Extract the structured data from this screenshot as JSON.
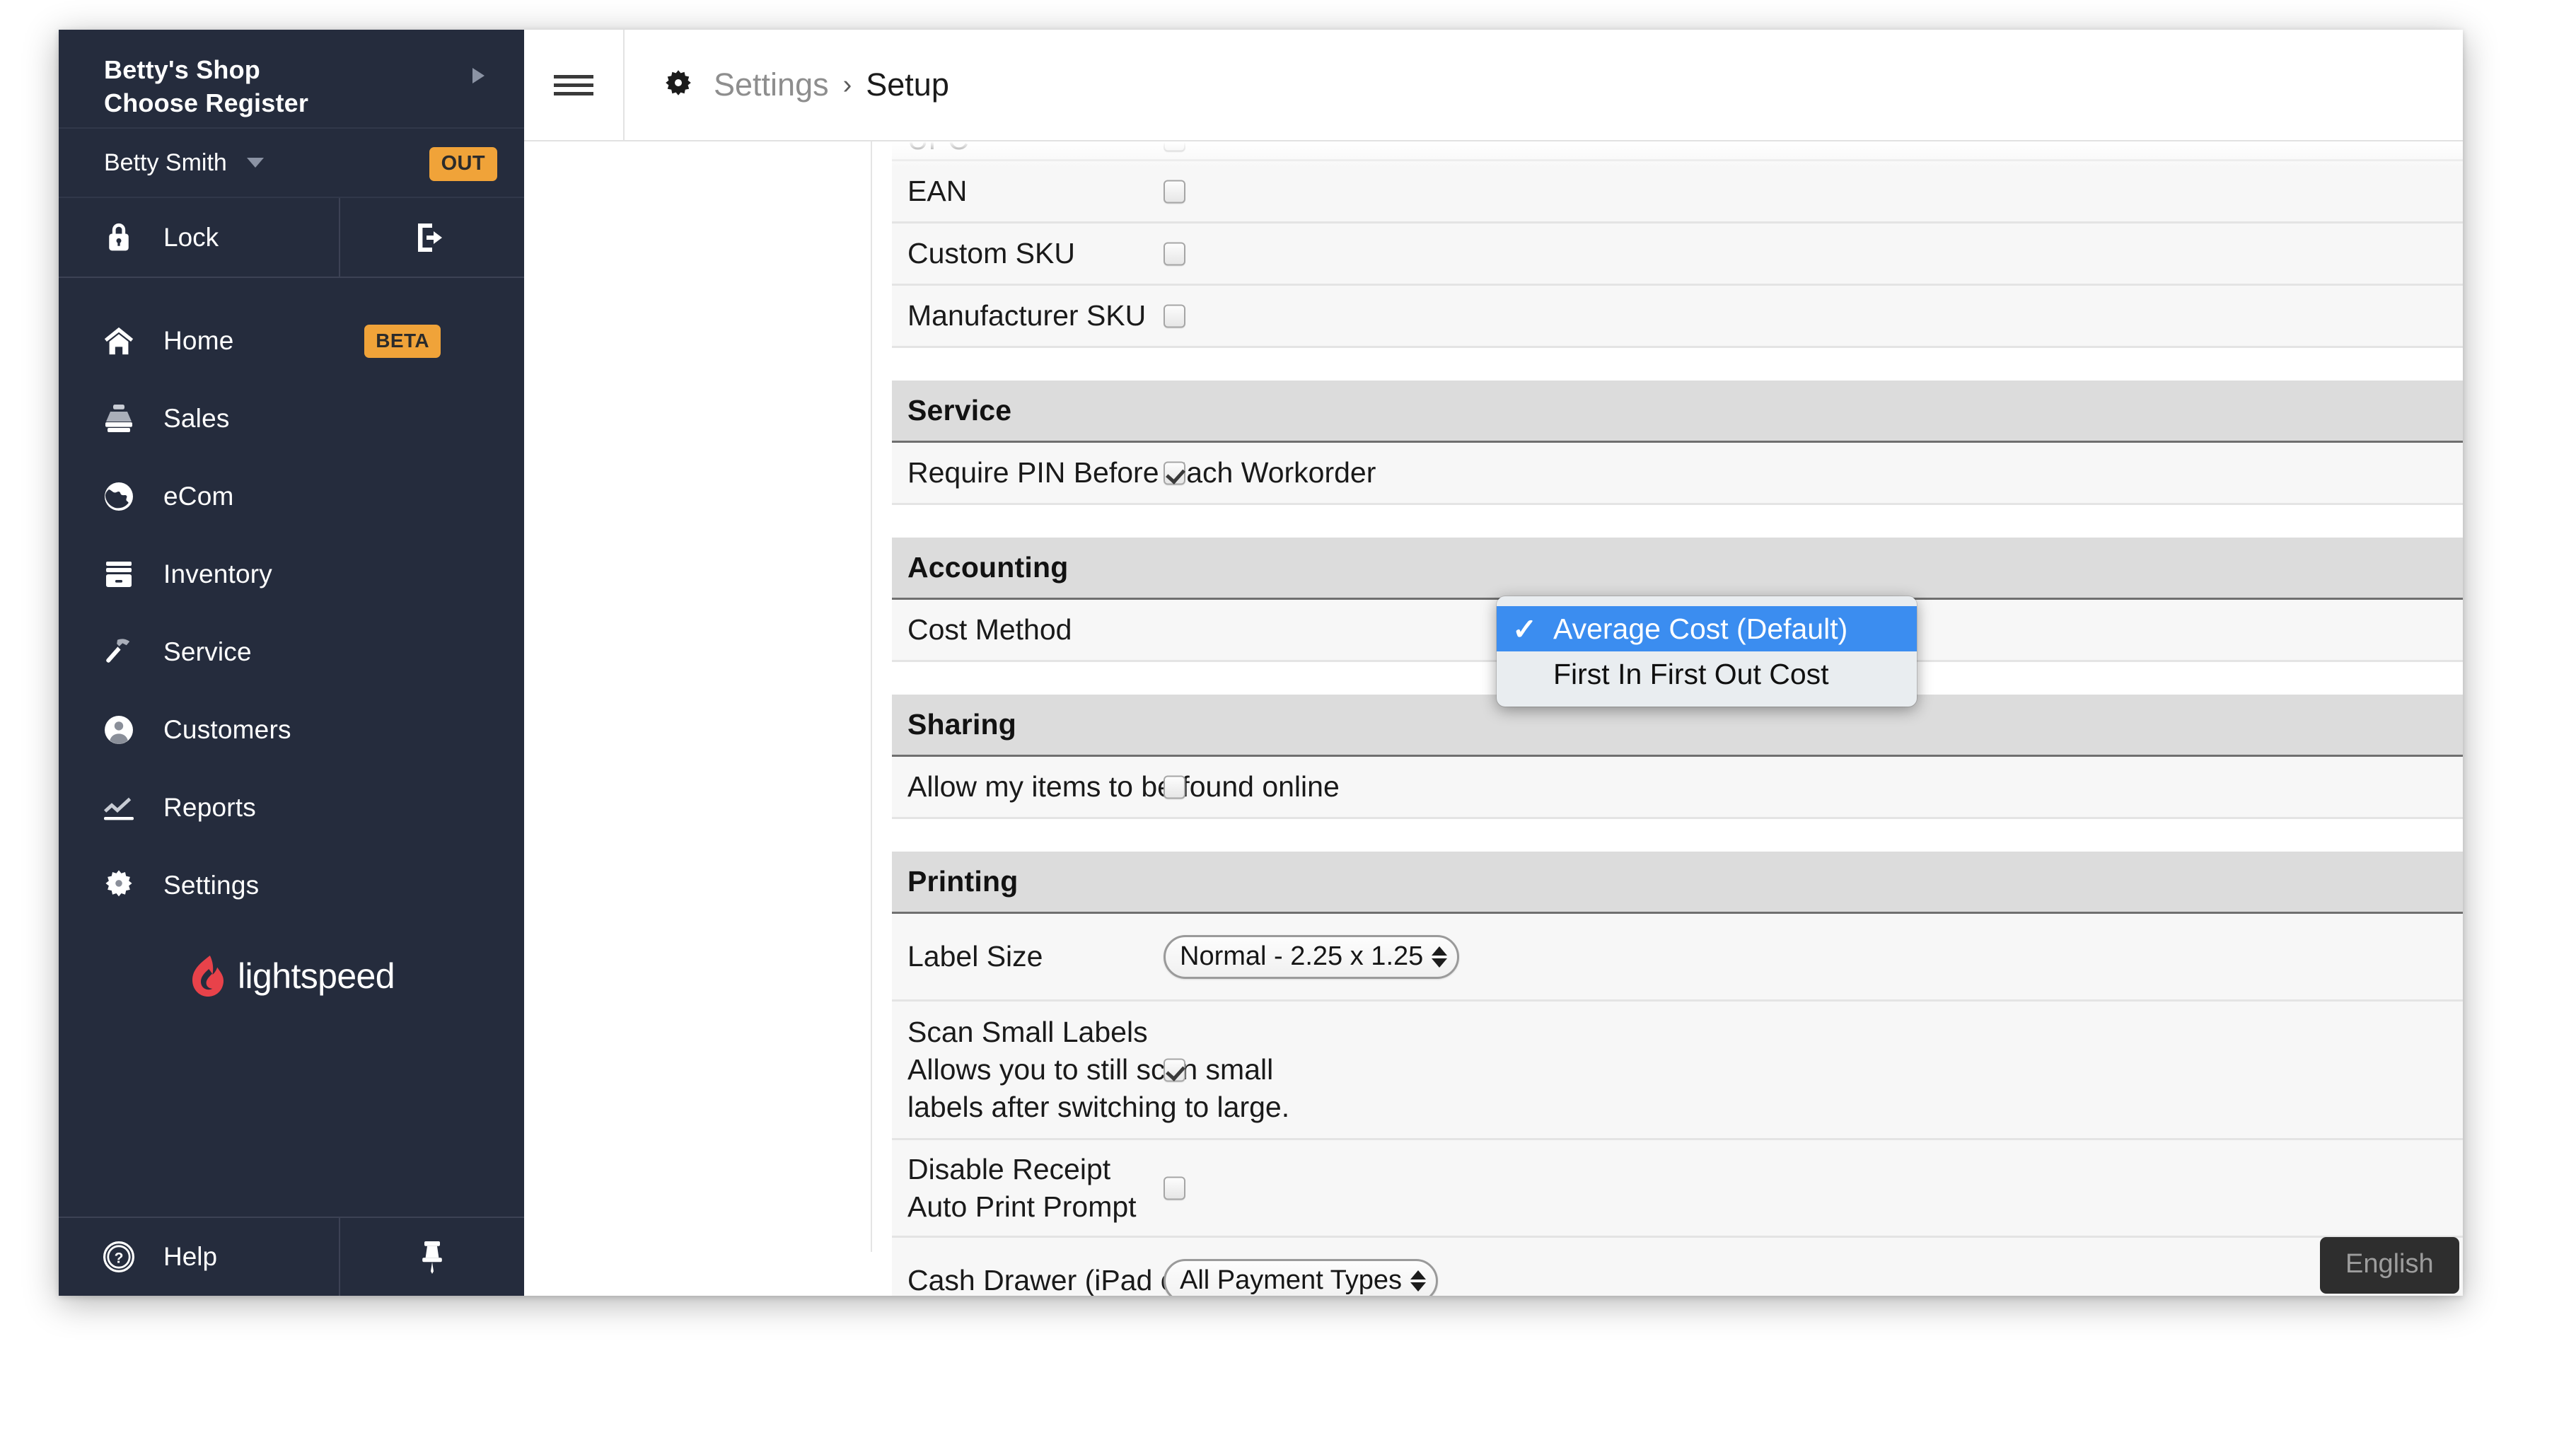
{
  "sidebar": {
    "shop_name": "Betty's Shop",
    "register_label": "Choose Register",
    "user_name": "Betty Smith",
    "clock_status": "OUT",
    "lock_label": "Lock",
    "nav_items": [
      {
        "label": "Home",
        "icon": "home-icon",
        "badge": "BETA"
      },
      {
        "label": "Sales",
        "icon": "register-icon",
        "badge": ""
      },
      {
        "label": "eCom",
        "icon": "globe-icon",
        "badge": ""
      },
      {
        "label": "Inventory",
        "icon": "boxes-icon",
        "badge": ""
      },
      {
        "label": "Service",
        "icon": "hammer-icon",
        "badge": ""
      },
      {
        "label": "Customers",
        "icon": "person-icon",
        "badge": ""
      },
      {
        "label": "Reports",
        "icon": "chart-line-icon",
        "badge": ""
      },
      {
        "label": "Settings",
        "icon": "gear-icon",
        "badge": ""
      }
    ],
    "brand": "lightspeed",
    "help_label": "Help"
  },
  "header": {
    "breadcrumb_parent": "Settings",
    "breadcrumb_separator": "›",
    "breadcrumb_current": "Setup"
  },
  "settings": {
    "top_rows": [
      {
        "label": "UPC",
        "checked": false
      },
      {
        "label": "EAN",
        "checked": false
      },
      {
        "label": "Custom SKU",
        "checked": false
      },
      {
        "label": "Manufacturer SKU",
        "checked": false
      }
    ],
    "sections": [
      {
        "title": "Service",
        "rows": [
          {
            "label": "Require PIN Before Each Workorder",
            "type": "checkbox",
            "checked": true
          }
        ]
      },
      {
        "title": "Accounting",
        "rows": [
          {
            "label": "Cost Method",
            "type": "select",
            "value": "Average Cost (Default)"
          }
        ]
      },
      {
        "title": "Sharing",
        "rows": [
          {
            "label": "Allow my items to be found online",
            "type": "checkbox",
            "checked": false
          }
        ]
      },
      {
        "title": "Printing",
        "rows": [
          {
            "label": "Label Size",
            "type": "select",
            "value": "Normal - 2.25 x 1.25"
          },
          {
            "label": "Scan Small Labels",
            "label_line2": "Allows you to still scan small",
            "label_line3": "labels after switching to large.",
            "type": "checkbox",
            "checked": true
          },
          {
            "label": "Disable Receipt",
            "label_line2": "Auto Print Prompt",
            "type": "checkbox",
            "checked": false
          },
          {
            "label": "Cash Drawer (iPad only)",
            "type": "select",
            "value": "All Payment Types"
          }
        ]
      }
    ]
  },
  "dropdown": {
    "checkmark": "✓",
    "options": [
      {
        "label": "Average Cost (Default)",
        "selected": true
      },
      {
        "label": "First In First Out Cost",
        "selected": false
      }
    ]
  },
  "language_badge": "English",
  "colors": {
    "sidebar_bg": "#252c3d",
    "badge_orange": "#f0a339",
    "dropdown_highlight": "#3b8df0",
    "brand_red": "#e8424a"
  }
}
